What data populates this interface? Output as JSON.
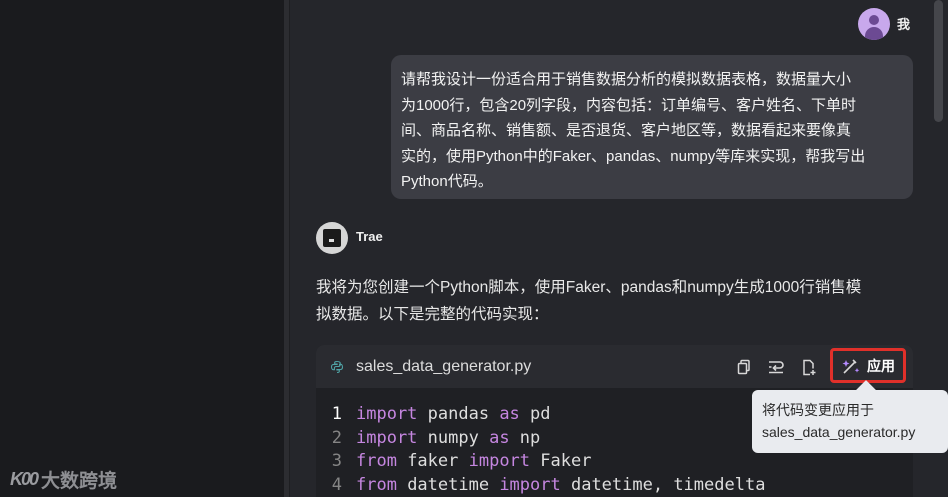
{
  "watermark": {
    "logo": "K00",
    "text": "大数跨境"
  },
  "user": {
    "name": "我"
  },
  "user_message": {
    "lines": [
      "请帮我设计一份适合用于销售数据分析的模拟数据表格，数据量大小",
      "为1000行，包含20列字段，内容包括：订单编号、客户姓名、下单时",
      "间、商品名称、销售额、是否退货、客户地区等，数据看起来要像真",
      "实的，使用Python中的Faker、pandas、numpy等库来实现，帮我写出",
      "Python代码。"
    ]
  },
  "assistant": {
    "name": "Trae",
    "intro_lines": [
      "我将为您创建一个Python脚本，使用Faker、pandas和numpy生成1000行销售模",
      "拟数据。以下是完整的代码实现："
    ]
  },
  "code_block": {
    "filename": "sales_data_generator.py",
    "apply_label": "应用",
    "toolbar_icons": [
      "copy-icon",
      "insert-icon",
      "add-file-icon",
      "apply-icon"
    ],
    "lines": [
      {
        "no": "1",
        "kw1": "import",
        "a": " pandas ",
        "kw2": "as",
        "b": " pd"
      },
      {
        "no": "2",
        "kw1": "import",
        "a": " numpy ",
        "kw2": "as",
        "b": " np"
      },
      {
        "no": "3",
        "kw1": "from",
        "a": " faker ",
        "kw2": "import",
        "b": " Faker"
      },
      {
        "no": "4",
        "kw1": "from",
        "a": " datetime ",
        "kw2": "import",
        "b": " datetime, timedelta"
      }
    ]
  },
  "tooltip": {
    "line1": "将代码变更应用于",
    "line2": "sales_data_generator.py"
  },
  "colors": {
    "accent_red": "#e0302a",
    "keyword": "#c586e0",
    "file_icon": "#4fa3a5"
  }
}
